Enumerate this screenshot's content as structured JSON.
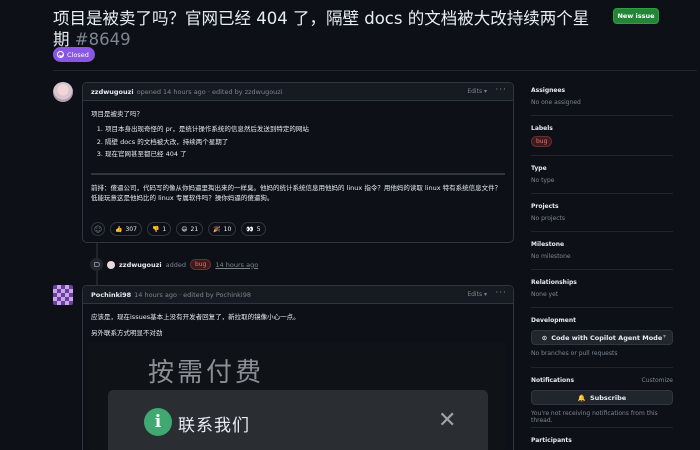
{
  "issue": {
    "title": "项目是被卖了吗？官网已经 404 了，隔壁 docs 的文档被大改持续两个星期",
    "number": "#8649",
    "status": "Closed",
    "new_issue_label": "New issue"
  },
  "comment1": {
    "author": "zzdwugouzi",
    "meta": "opened 14 hours ago · edited by zzdwugouzi",
    "edits_label": "Edits ▾",
    "intro": "项目是被卖了吗？",
    "list": [
      "项目本身出现奇怪的 pr，是统计操作系统的信息然后发送到特定的网站",
      "隔壁 docs 的文档被大改，持续两个星期了",
      "现在官网甚至都已经 404 了"
    ],
    "para": "前排：傻逼公司，代码写的像从你妈逼里掏出来的一样臭。他妈的统计系统信息用他妈的 linux 指令？用他妈的读取 linux 特有系统信息文件？低能玩意这是他妈比的 linux 专属软件吗？操你妈逼的傻逼狗。",
    "reactions": [
      {
        "emoji": "👍",
        "count": "307"
      },
      {
        "emoji": "👎",
        "count": "1"
      },
      {
        "emoji": "😄",
        "count": "21"
      },
      {
        "emoji": "🎉",
        "count": "10"
      },
      {
        "emoji": "👀",
        "count": "5"
      }
    ]
  },
  "event": {
    "actor": "zzdwugouzi",
    "action": "added",
    "label": "bug",
    "time": "14 hours ago"
  },
  "comment2": {
    "author": "Pochinki98",
    "meta": "14 hours ago · edited by Pochinki98",
    "edits_label": "Edits ▾",
    "line1": "应该是，现在issues基本上没有开发者回复了，新拉取的镜像小心一点。",
    "line2": "另外联系方式明显不对劲",
    "image_text": "按需付费",
    "dialog_title": "联系我们"
  },
  "sidebar": {
    "assignees": {
      "title": "Assignees",
      "value": "No one assigned"
    },
    "labels": {
      "title": "Labels",
      "value": "bug"
    },
    "type": {
      "title": "Type",
      "value": "No type"
    },
    "projects": {
      "title": "Projects",
      "value": "No projects"
    },
    "milestone": {
      "title": "Milestone",
      "value": "No milestone"
    },
    "relationships": {
      "title": "Relationships",
      "value": "None yet"
    },
    "development": {
      "title": "Development",
      "button": "Code with Copilot Agent Mode",
      "value": "No branches or pull requests"
    },
    "notifications": {
      "title": "Notifications",
      "customize": "Customize",
      "button": "Subscribe",
      "value": "You're not receiving notifications from this thread."
    },
    "participants": {
      "title": "Participants"
    }
  },
  "colors": {
    "accent_green": "#238636",
    "closed_purple": "#8957e5",
    "bug_red": "#f47067",
    "bg": "#0d1117"
  },
  "icons": [
    "closed-issue-icon",
    "kebab-icon",
    "smiley-icon",
    "tag-icon",
    "info-icon",
    "close-icon",
    "copilot-icon",
    "bell-icon"
  ]
}
